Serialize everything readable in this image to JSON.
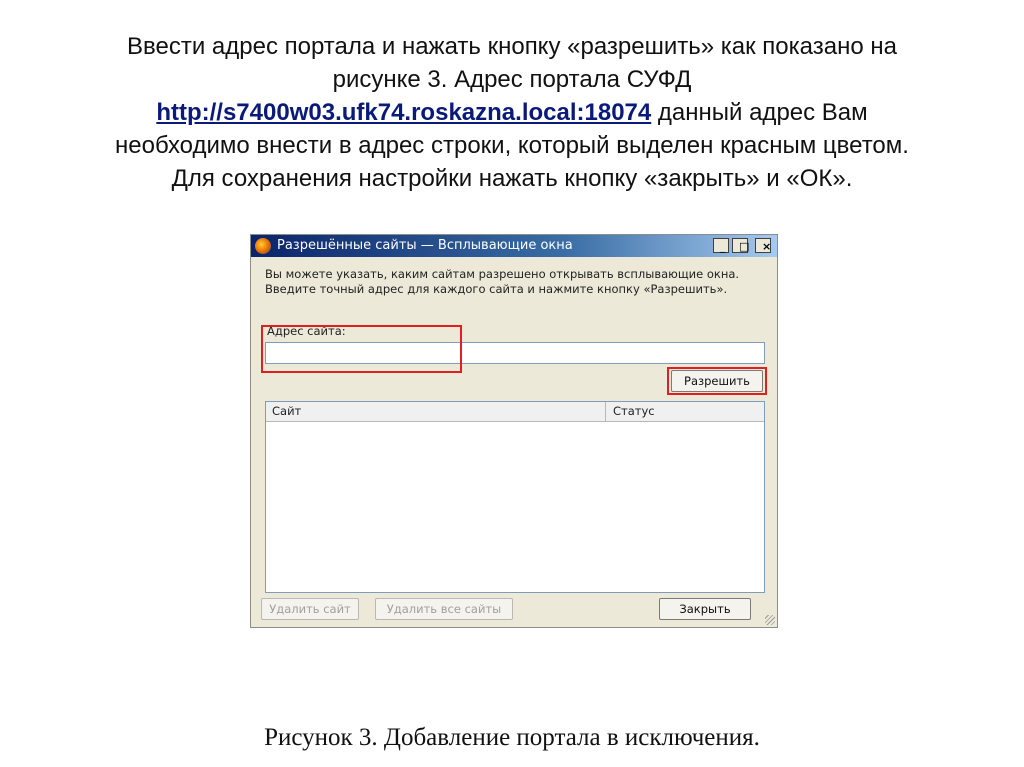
{
  "instructions": {
    "line1": "Ввести адрес портала и нажать кнопку «разрешить» как показано на",
    "line2": "рисунке 3. Адрес портала СУФД",
    "portal_url": "http://s7400w03.ufk74.roskazna.local:18074",
    "line3_rest": " данный адрес Вам",
    "line4": "необходимо внести в адрес строки, который выделен красным цветом.",
    "line5": "Для сохранения настройки нажать кнопку «закрыть» и «ОК»."
  },
  "dialog": {
    "title": "Разрешённые сайты — Всплывающие окна",
    "minimize_glyph": "_",
    "maximize_glyph": "□",
    "close_glyph": "×",
    "description": "Вы можете указать, каким сайтам разрешено открывать всплывающие окна. Введите точный адрес для каждого сайта и нажмите кнопку «Разрешить».",
    "address_label": "Адрес сайта:",
    "address_value": "",
    "allow_button": "Разрешить",
    "columns": {
      "site": "Сайт",
      "status": "Статус"
    },
    "sites": [],
    "remove_site_button": "Удалить сайт",
    "remove_all_button": "Удалить все сайты",
    "close_button": "Закрыть"
  },
  "caption": "Рисунок 3. Добавление портала в исключения.",
  "colors": {
    "highlight": "#e02020",
    "titlebar_start": "#0a246a",
    "titlebar_end": "#a6caf0",
    "link": "#0a1a7a"
  }
}
